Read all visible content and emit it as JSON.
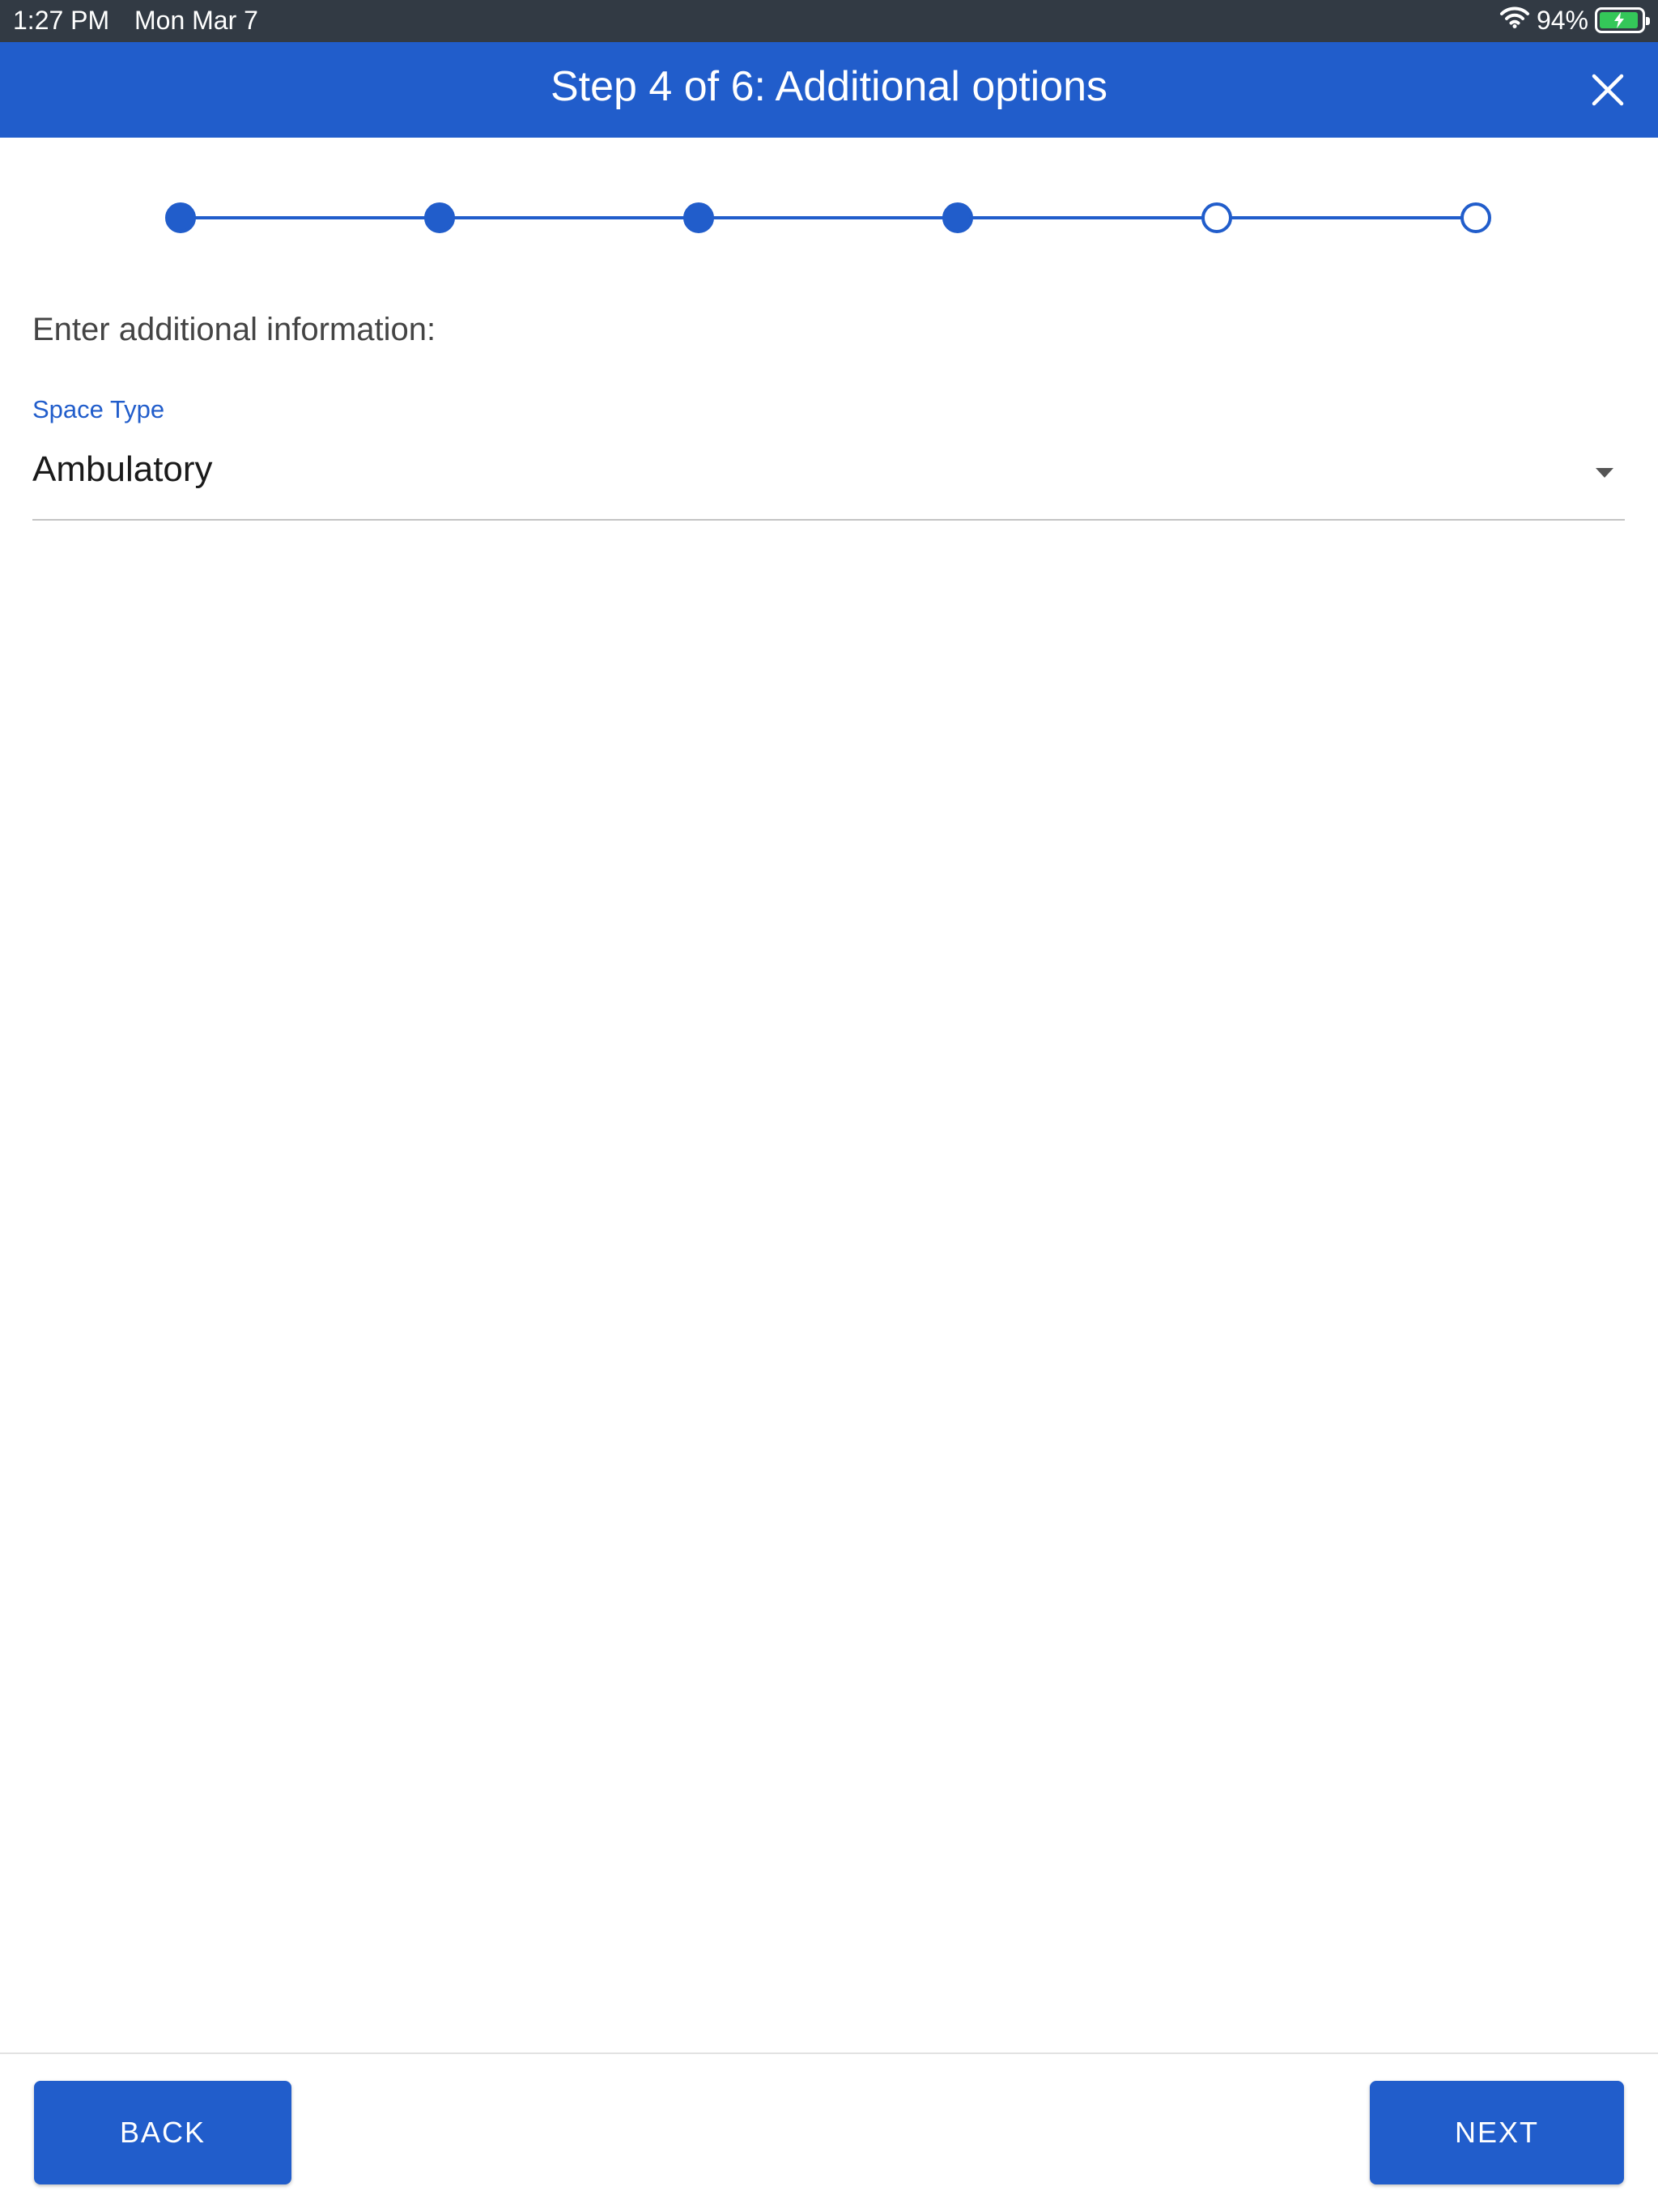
{
  "status_bar": {
    "time": "1:27 PM",
    "date": "Mon Mar 7",
    "battery_percent_label": "94%",
    "battery_level": 0.94,
    "wifi_icon": "wifi-icon",
    "battery_icon": "battery-charging-icon"
  },
  "header": {
    "title": "Step 4 of 6: Additional options",
    "close_icon": "close-icon"
  },
  "stepper": {
    "total_steps": 6,
    "completed_steps": 4,
    "color": "#215dcb"
  },
  "form": {
    "instruction": "Enter additional information:",
    "space_type": {
      "label": "Space Type",
      "value": "Ambulatory",
      "dropdown_icon": "chevron-down-icon"
    }
  },
  "footer": {
    "back_label": "BACK",
    "next_label": "NEXT"
  },
  "colors": {
    "brand": "#215dcb",
    "status_bar": "#323a44",
    "battery_fill": "#34c759"
  }
}
